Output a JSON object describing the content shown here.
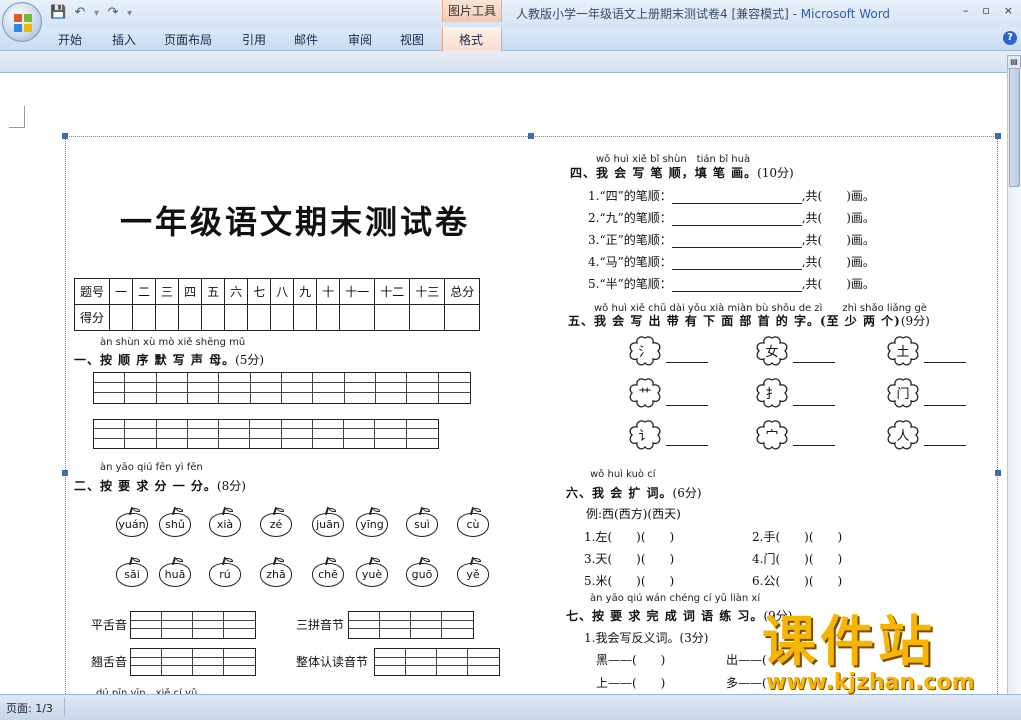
{
  "titlebar": {
    "context_tool": "图片工具",
    "doc_title": "人教版小学一年级语文上册期末测试卷4 [兼容模式] - ",
    "app_name": "Microsoft Word",
    "controls": [
      "–",
      "▫",
      "×"
    ]
  },
  "qat": {
    "icons": [
      "save-icon",
      "undo-icon",
      "redo-icon",
      "customize-icon"
    ]
  },
  "tabs": [
    "开始",
    "插入",
    "页面布局",
    "引用",
    "邮件",
    "审阅",
    "视图",
    "格式"
  ],
  "status": {
    "page": "页面: 1/3"
  },
  "exam": {
    "title": "一年级语文期末测试卷",
    "score_table": {
      "row1": [
        "题号",
        "一",
        "二",
        "三",
        "四",
        "五",
        "六",
        "七",
        "八",
        "九",
        "十",
        "十一",
        "十二",
        "十三",
        "总分"
      ],
      "row2_label": "得分"
    },
    "q1": {
      "pinyin": "àn shùn xù mò xiě shēng mǔ",
      "head": "一、按 顺 序 默 写 声 母。",
      "pts": "(5分)"
    },
    "q2": {
      "pinyin": "àn yāo qiú fēn yì fēn",
      "head": "二、按 要 求 分 一 分。",
      "pts": "(8分)",
      "apples_row1": [
        "yuán",
        "shǔ",
        "xià",
        "zé",
        "juān",
        "yīng",
        "suì",
        "cù"
      ],
      "apples_row2": [
        "sāi",
        "huā",
        "rú",
        "zhā",
        "chē",
        "yuè",
        "guō",
        "yě"
      ],
      "labels": [
        "平舌音",
        "三拼音节",
        "翘舌音",
        "整体认读音节"
      ]
    },
    "q_bottom_pinyin": "dú pīn yīn　xiě cí yǔ",
    "q4": {
      "pinyin": "wǒ huì xiě bǐ shùn　tián bǐ huà",
      "head": "四、我 会 写 笔 顺，填 笔 画。",
      "pts": "(10分)",
      "lines": [
        {
          "num": "1.",
          "char": "“四”的笔顺：",
          "tail": ",共(　　)画。"
        },
        {
          "num": "2.",
          "char": "“九”的笔顺：",
          "tail": ",共(　　)画。"
        },
        {
          "num": "3.",
          "char": "“正”的笔顺：",
          "tail": ",共(　　)画。"
        },
        {
          "num": "4.",
          "char": "“马”的笔顺：",
          "tail": ",共(　　)画。"
        },
        {
          "num": "5.",
          "char": "“半”的笔顺：",
          "tail": ",共(　　)画。"
        }
      ]
    },
    "q5": {
      "pinyin": "wǒ huì xiě chū dài yǒu xià miàn bù shǒu de zì　　zhì shǎo liǎng gè",
      "head": "五、我 会 写 出 带 有 下 面 部 首 的 字。(至 少 两 个)",
      "pts": "(9分)",
      "radicals": [
        "氵",
        "女",
        "土",
        "艹",
        "扌",
        "门",
        "讠",
        "宀",
        "人"
      ]
    },
    "q6": {
      "pinyin": "wǒ huì kuò cí",
      "head": "六、我 会 扩 词。",
      "pts": "(6分)",
      "example": "例:西(西方)(西天)",
      "items": [
        "1.左(　　)(　　)",
        "2.手(　　)(　　)",
        "3.天(　　)(　　)",
        "4.门(　　)(　　)",
        "5.米(　　)(　　)",
        "6.公(　　)(　　)"
      ]
    },
    "q7": {
      "pinyin": "àn yāo qiú wán chéng cí yǔ liàn xí",
      "head": "七、按 要 求 完 成 词 语 练 习。",
      "pts": "(9分)",
      "sub1": "1.我会写反义词。(3分)",
      "antonyms": [
        "黑——(　　)",
        "出——(",
        "上——(　　)",
        "多——("
      ]
    }
  },
  "watermark": {
    "main": "课件站",
    "url": "www.kjzhan.com"
  }
}
